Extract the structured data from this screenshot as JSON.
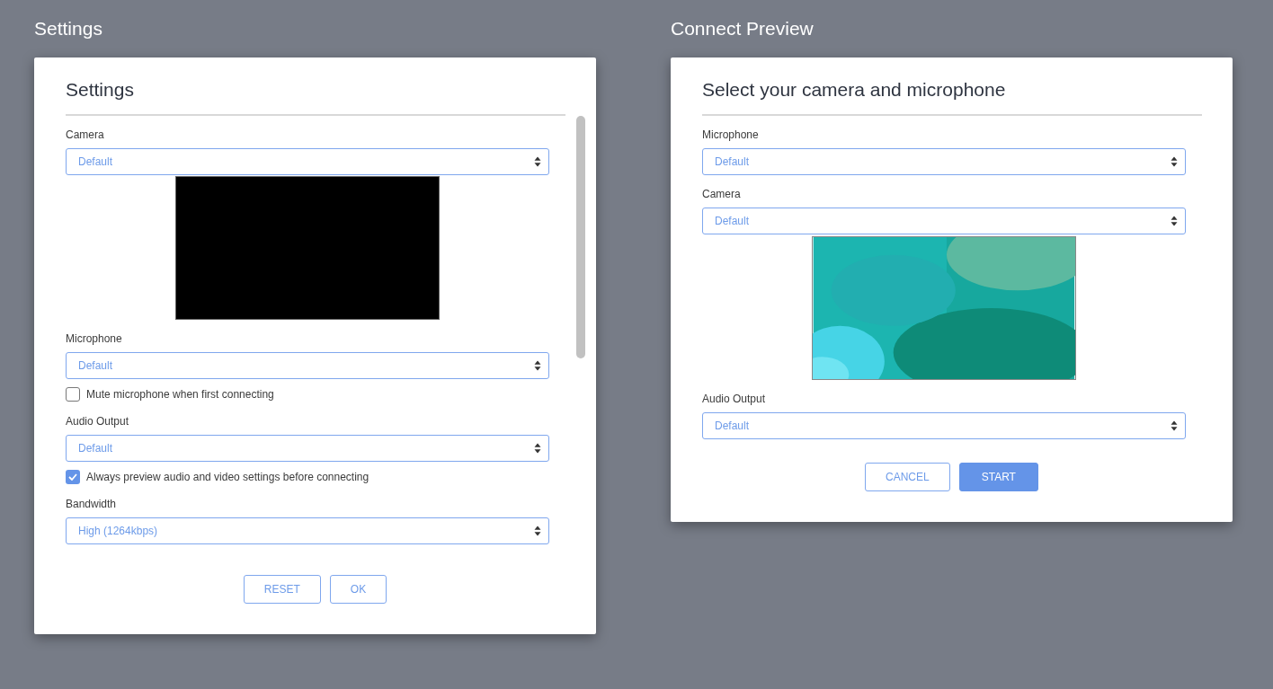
{
  "panels": [
    {
      "heading": "Settings",
      "title": "Settings",
      "scrollbar": true,
      "items": [
        {
          "kind": "select",
          "label": "Camera",
          "value": "Default"
        },
        {
          "kind": "video",
          "live": false
        },
        {
          "kind": "select",
          "label": "Microphone",
          "value": "Default"
        },
        {
          "kind": "checkbox",
          "label": "Mute microphone when first connecting",
          "checked": false
        },
        {
          "kind": "select",
          "label": "Audio Output",
          "value": "Default"
        },
        {
          "kind": "checkbox",
          "label": "Always preview audio and video settings before connecting",
          "checked": true
        },
        {
          "kind": "select",
          "label": "Bandwidth",
          "value": "High (1264kbps)"
        }
      ],
      "buttons": [
        {
          "label": "RESET",
          "primary": false
        },
        {
          "label": "OK",
          "primary": false
        }
      ]
    },
    {
      "heading": "Connect Preview",
      "title": "Select your camera and microphone",
      "scrollbar": false,
      "items": [
        {
          "kind": "select",
          "label": "Microphone",
          "value": "Default"
        },
        {
          "kind": "select",
          "label": "Camera",
          "value": "Default"
        },
        {
          "kind": "video",
          "live": true
        },
        {
          "kind": "select",
          "label": "Audio Output",
          "value": "Default"
        }
      ],
      "buttons": [
        {
          "label": "CANCEL",
          "primary": false
        },
        {
          "label": "START",
          "primary": true
        }
      ]
    }
  ]
}
